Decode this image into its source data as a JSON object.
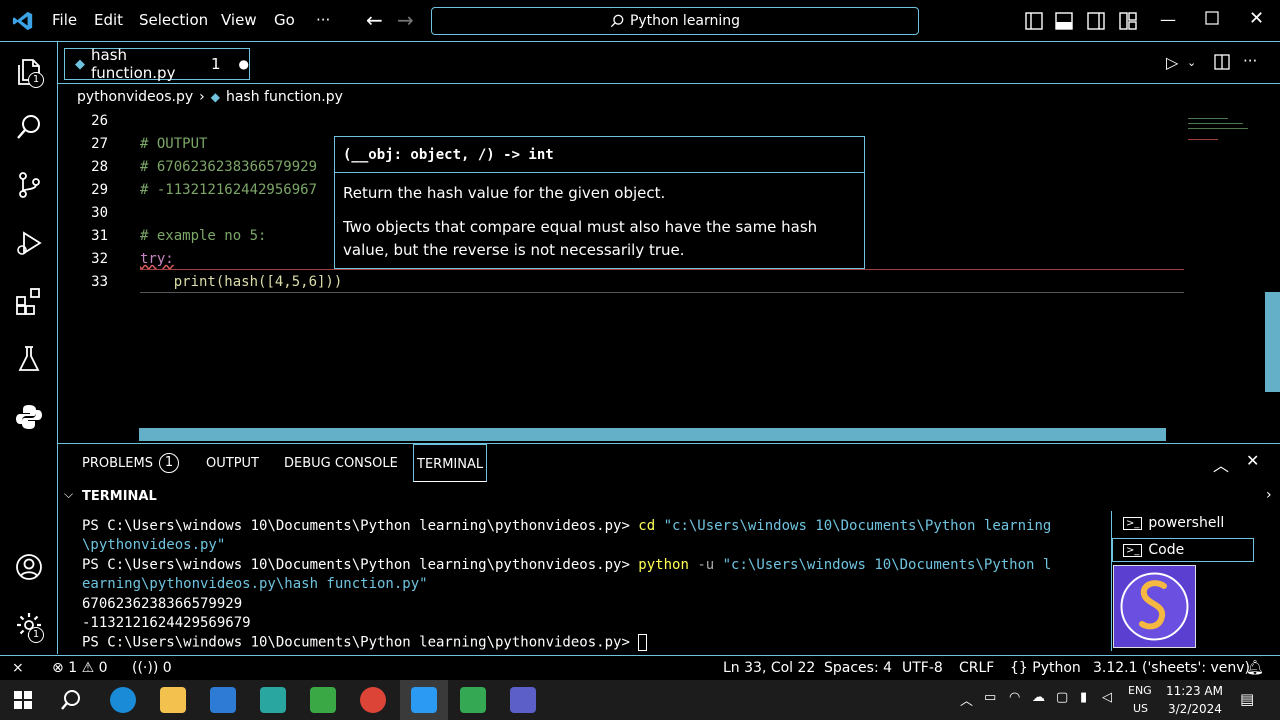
{
  "titlebar": {
    "menu": [
      "File",
      "Edit",
      "Selection",
      "View",
      "Go",
      "···"
    ],
    "search": "Python learning"
  },
  "activity": {
    "explorer_badge": "1",
    "settings_badge": "1"
  },
  "tab": {
    "label": "hash function.py",
    "count": "1"
  },
  "breadcrumb": [
    "pythonvideos.py",
    "hash function.py"
  ],
  "editor": {
    "lines": [
      {
        "no": "26",
        "text": ""
      },
      {
        "no": "27",
        "text": "# OUTPUT"
      },
      {
        "no": "28",
        "text": "# 6706236238366579929"
      },
      {
        "no": "29",
        "text": "# -113212162442956967"
      },
      {
        "no": "30",
        "text": ""
      },
      {
        "no": "31",
        "text": "# example no 5:"
      },
      {
        "no": "32",
        "text": "try:"
      },
      {
        "no": "33",
        "text": "    print(hash([4,5,6]))"
      }
    ]
  },
  "hover": {
    "signature": "(__obj: object, /) -> int",
    "para1": "Return the hash value for the given object.",
    "para2": "Two objects that compare equal must also have the same hash value, but the reverse is not necessarily true."
  },
  "panel": {
    "tabs": [
      "PROBLEMS",
      "OUTPUT",
      "DEBUG CONSOLE",
      "TERMINAL"
    ],
    "problems_count": "1",
    "section": "TERMINAL",
    "shells": [
      "powershell",
      "Code"
    ],
    "terminal_lines": [
      {
        "prompt": "PS C:\\Users\\windows 10\\Documents\\Python learning\\pythonvideos.py> ",
        "cmd": "cd ",
        "arg": "\"c:\\Users\\windows 10\\Documents\\Python learning"
      },
      {
        "prompt": "",
        "cmd": "",
        "arg": "\\pythonvideos.py\""
      },
      {
        "prompt": "PS C:\\Users\\windows 10\\Documents\\Python learning\\pythonvideos.py> ",
        "cmd": "python ",
        "flag": "-u ",
        "arg": "\"c:\\Users\\windows 10\\Documents\\Python l"
      },
      {
        "prompt": "",
        "cmd": "",
        "arg": "earning\\pythonvideos.py\\hash function.py\""
      },
      {
        "prompt": "6706236238366579929",
        "cmd": "",
        "arg": ""
      },
      {
        "prompt": "-1132121624429569679",
        "cmd": "",
        "arg": ""
      },
      {
        "prompt": "PS C:\\Users\\windows 10\\Documents\\Python learning\\pythonvideos.py> ",
        "cmd": "",
        "arg": ""
      }
    ]
  },
  "statusbar": {
    "errors": "1",
    "warnings": "0",
    "ports": "0",
    "position": "Ln 33, Col 22",
    "spaces": "Spaces: 4",
    "encoding": "UTF-8",
    "eol": "CRLF",
    "language": "Python",
    "interpreter": "3.12.1 ('sheets': venv)"
  },
  "taskbar": {
    "lang1": "ENG",
    "lang2": "US",
    "time": "11:23 AM",
    "date": "3/2/2024"
  },
  "colors": {
    "accent": "#6fc3df",
    "comment": "#7ca668",
    "keyword": "#c586c0",
    "function": "#dcdcaa",
    "terminal_cmd": "#ffff55"
  }
}
